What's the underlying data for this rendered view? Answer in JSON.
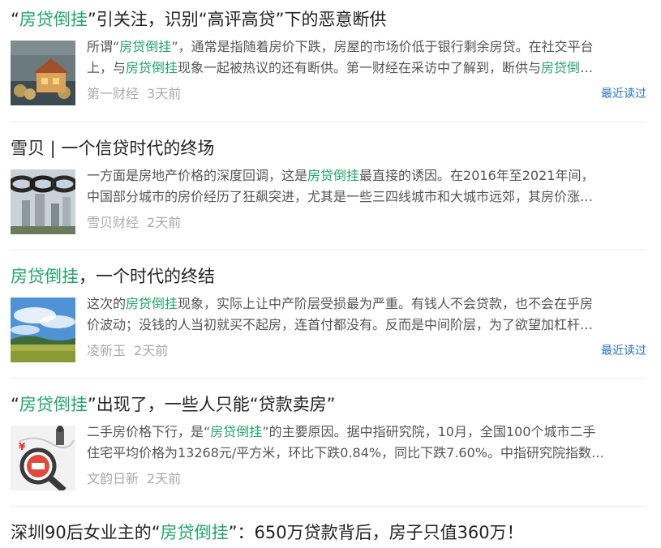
{
  "colors": {
    "highlight": "#21a66a",
    "title": "#222222",
    "snippet": "#555555",
    "meta": "#aaaaaa",
    "link": "#2a73c4"
  },
  "articles": [
    {
      "title": [
        {
          "t": "“",
          "hl": false
        },
        {
          "t": "房贷倒挂",
          "hl": true
        },
        {
          "t": "”引关注，识别“高评高贷”下的恶意断供",
          "hl": false
        }
      ],
      "thumb_icon": "house-model-coins-image",
      "snippet_lines": [
        [
          {
            "t": "所谓“",
            "hl": false
          },
          {
            "t": "房贷倒挂",
            "hl": true
          },
          {
            "t": "”，通常是指随着房价下跌，房屋的市场价低于银行剩余房贷。在社交平台",
            "hl": false
          }
        ],
        [
          {
            "t": "上，与",
            "hl": false
          },
          {
            "t": "房贷倒挂",
            "hl": true
          },
          {
            "t": "现象一起被热议的还有断供。第一财经在采访中了解到，断供与",
            "hl": false
          },
          {
            "t": "房贷倒",
            "hl": true
          },
          {
            "t": "…",
            "hl": false
          }
        ]
      ],
      "source": "第一财经",
      "time": "3天前",
      "recent_label": "最近读过"
    },
    {
      "title": [
        {
          "t": "雪贝 | 一个信贷时代的终场",
          "hl": false
        }
      ],
      "thumb_icon": "chain-buildings-image",
      "snippet_lines": [
        [
          {
            "t": "一方面是房地产价格的深度回调，这是",
            "hl": false
          },
          {
            "t": "房贷倒挂",
            "hl": true
          },
          {
            "t": "最直接的诱因。在2016年至2021年间，",
            "hl": false
          }
        ],
        [
          {
            "t": "中国部分城市的房价经历了狂飙突进，尤其是一些三四线城市和大城市远郊，其房价涨…",
            "hl": false
          }
        ]
      ],
      "source": "雪贝财经",
      "time": "2天前",
      "recent_label": ""
    },
    {
      "title": [
        {
          "t": "房贷倒挂",
          "hl": true
        },
        {
          "t": "，一个时代的终结",
          "hl": false
        }
      ],
      "thumb_icon": "landscape-sky-field-image",
      "snippet_lines": [
        [
          {
            "t": "这次的",
            "hl": false
          },
          {
            "t": "房贷倒挂",
            "hl": true
          },
          {
            "t": "现象，实际上让中产阶层受损最为严重。有钱人不会贷款，也不会在乎房",
            "hl": false
          }
        ],
        [
          {
            "t": "价波动；没钱的人当初就买不起房，连首付都没有。反而是中间阶层，为了欲望加杠杆…",
            "hl": false
          }
        ]
      ],
      "source": "凌新玉",
      "time": "2天前",
      "recent_label": "最近读过"
    },
    {
      "title": [
        {
          "t": "“",
          "hl": false
        },
        {
          "t": "房贷倒挂",
          "hl": true
        },
        {
          "t": "”出现了，一些人只能“贷款卖房”",
          "hl": false
        }
      ],
      "thumb_icon": "magnifier-loan-image",
      "snippet_lines": [
        [
          {
            "t": "二手房价格下行，是“",
            "hl": false
          },
          {
            "t": "房贷倒挂",
            "hl": true
          },
          {
            "t": "”的主要原因。据中指研究院，10月，全国100个城市二手",
            "hl": false
          }
        ],
        [
          {
            "t": "住宅平均价格为13268元/平方米，环比下跌0.84%，同比下跌7.60%。中指研究院指数…",
            "hl": false
          }
        ]
      ],
      "source": "文韵日新",
      "time": "2天前",
      "recent_label": ""
    }
  ],
  "last_title": [
    {
      "t": "深圳90后女业主的“",
      "hl": false
    },
    {
      "t": "房贷倒挂",
      "hl": true
    },
    {
      "t": "”：650万贷款背后，房子只值360万！",
      "hl": false
    }
  ]
}
